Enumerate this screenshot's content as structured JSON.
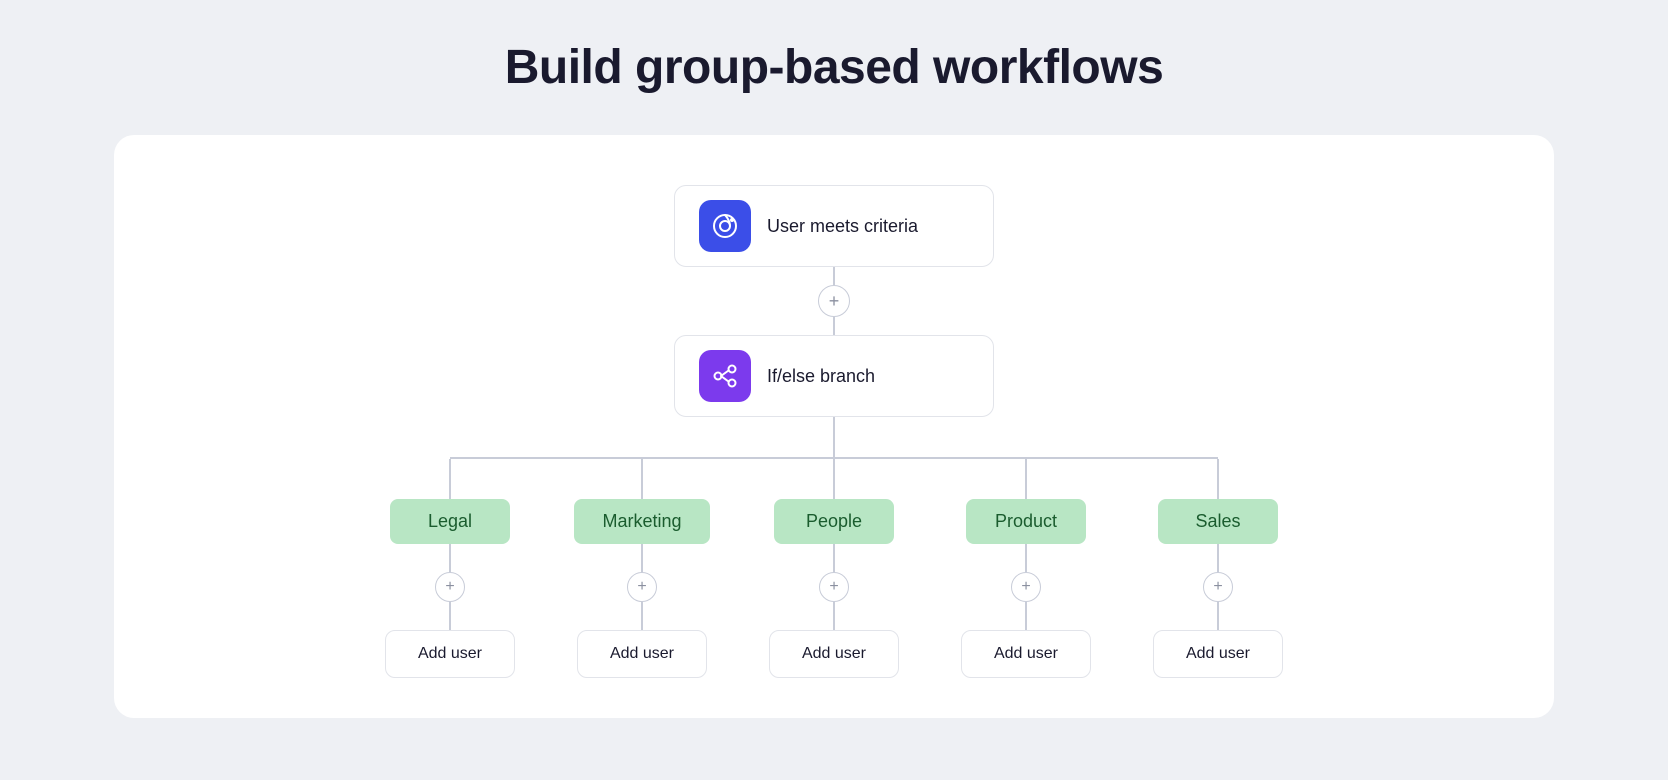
{
  "page": {
    "title": "Build group-based workflows"
  },
  "workflow": {
    "trigger_node": {
      "label": "User meets criteria",
      "icon_type": "blue",
      "icon_name": "criteria-icon"
    },
    "branch_node": {
      "label": "If/else branch",
      "icon_type": "purple",
      "icon_name": "branch-icon"
    },
    "add_button_label": "+",
    "branches": [
      {
        "label": "Legal",
        "add_user_label": "Add user"
      },
      {
        "label": "Marketing",
        "add_user_label": "Add user"
      },
      {
        "label": "People",
        "add_user_label": "Add user"
      },
      {
        "label": "Product",
        "add_user_label": "Add user"
      },
      {
        "label": "Sales",
        "add_user_label": "Add user"
      }
    ]
  }
}
